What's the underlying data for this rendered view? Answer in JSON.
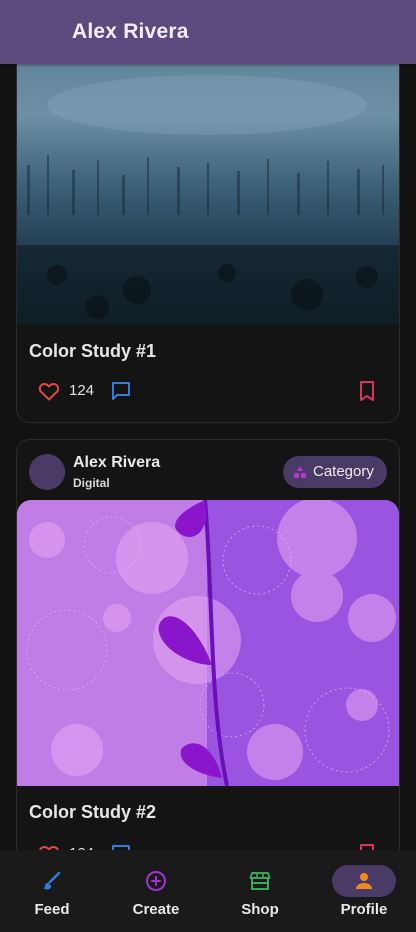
{
  "app_bar": {
    "title": "Alex Rivera"
  },
  "posts": [
    {
      "title": "Color Study #1",
      "likes": "124"
    },
    {
      "author": "Alex Rivera",
      "subtitle": "Digital",
      "category_label": "Category",
      "title": "Color Study #2",
      "likes": "124"
    }
  ],
  "nav": [
    {
      "label": "Feed",
      "icon": "brush-icon"
    },
    {
      "label": "Create",
      "icon": "add-circle-icon"
    },
    {
      "label": "Shop",
      "icon": "storefront-icon"
    },
    {
      "label": "Profile",
      "icon": "person-icon",
      "active": true
    }
  ],
  "colors": {
    "app_bar": "#5c4a7e",
    "like": "#e04848",
    "comment": "#2f7de1",
    "bookmark": "#e0305c",
    "feed_icon": "#2f7de1",
    "create_icon": "#a035d0",
    "shop_icon": "#3aa85a",
    "profile_icon": "#f08a1e",
    "chip_icon": "#b03ad0"
  }
}
